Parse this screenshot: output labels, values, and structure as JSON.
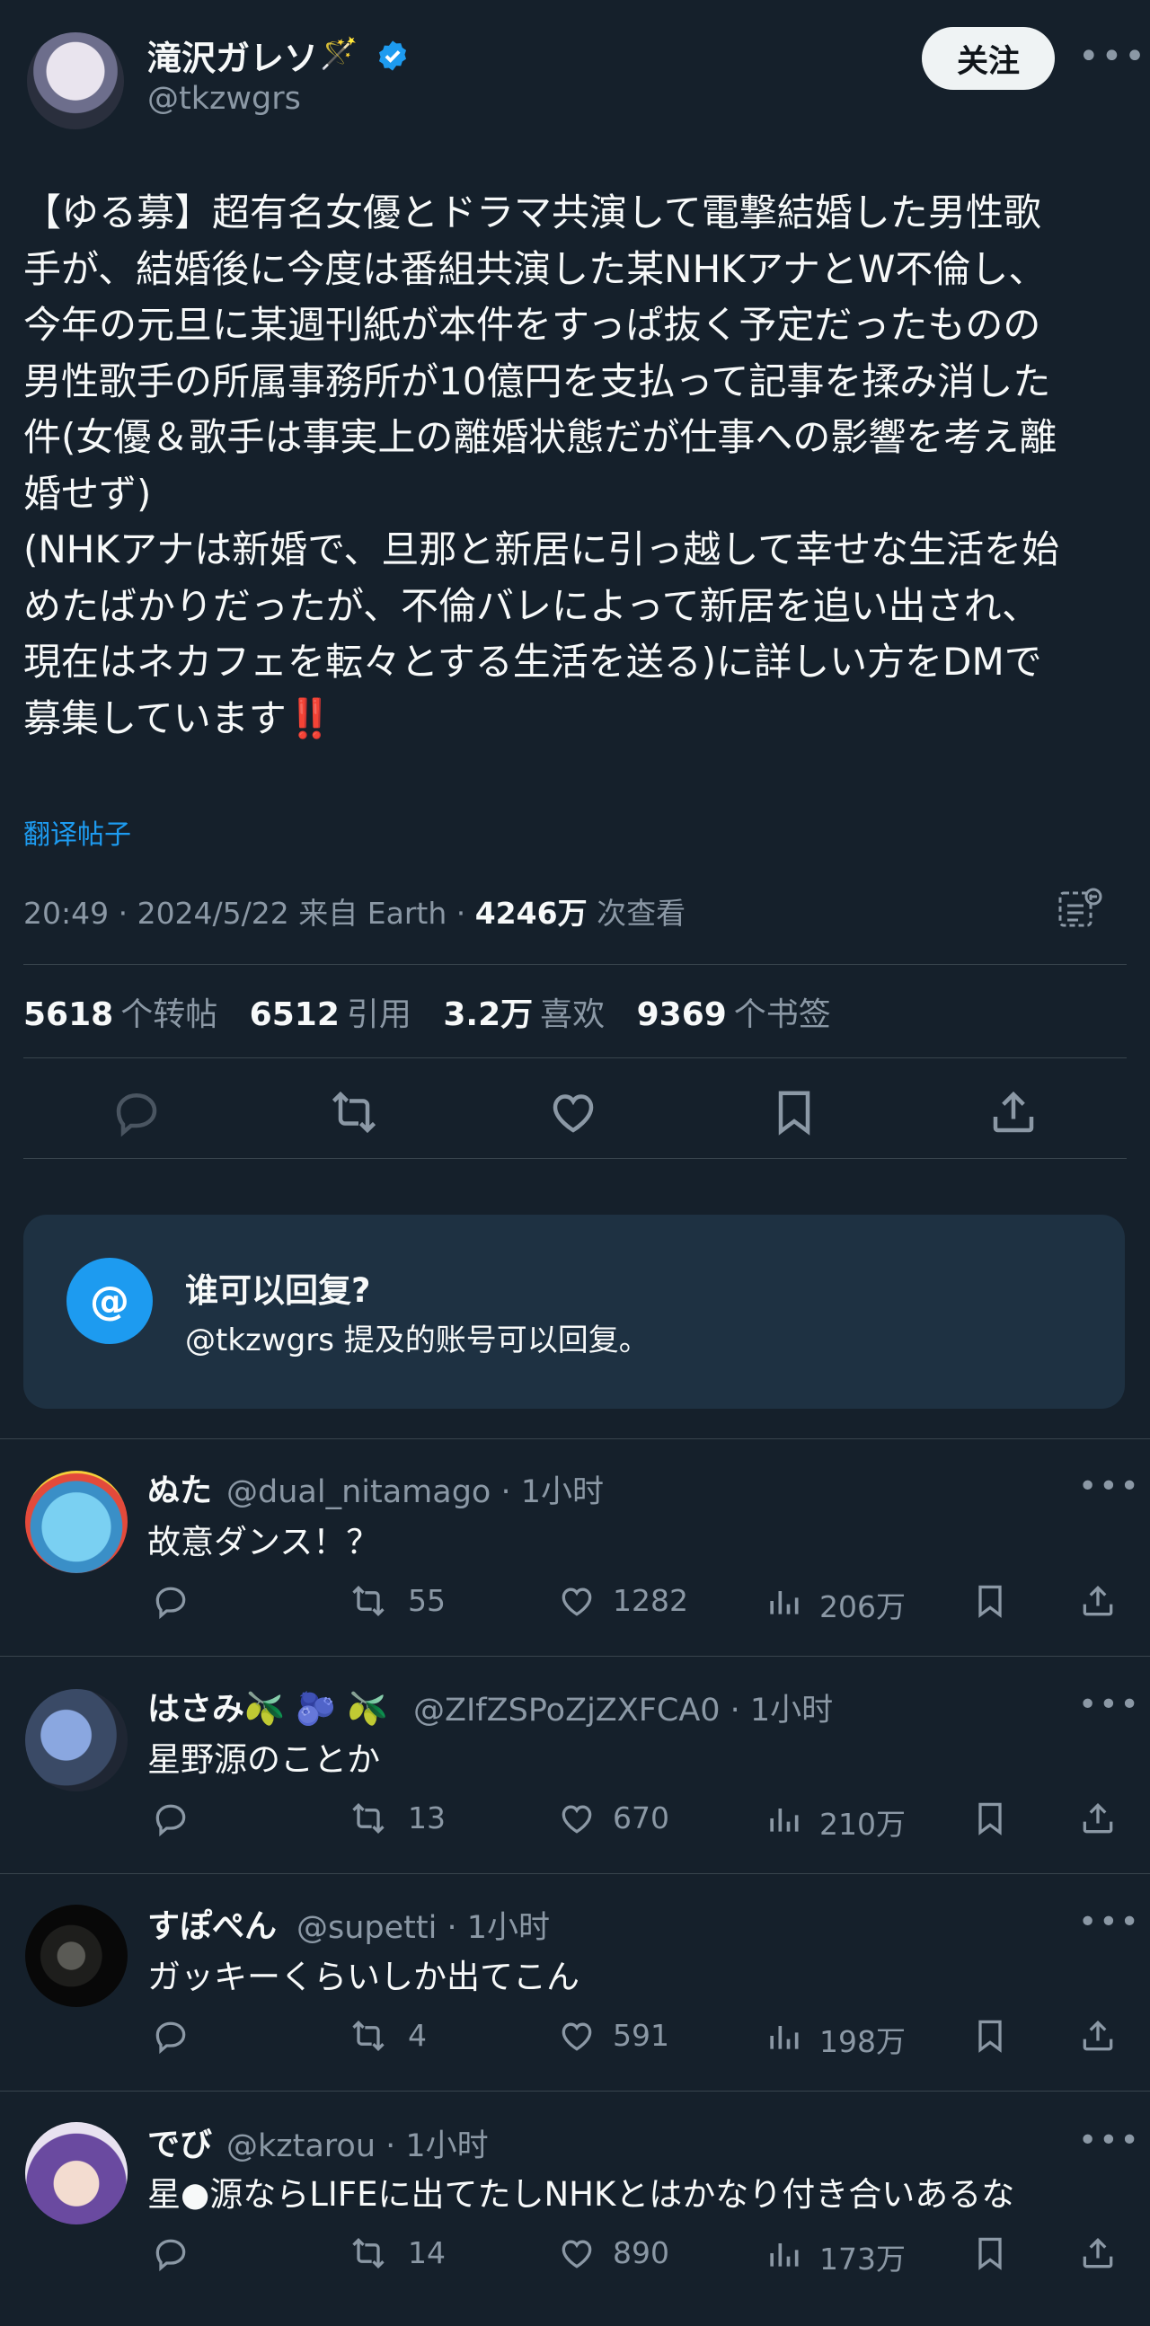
{
  "author": {
    "name": "滝沢ガレソ",
    "name_emoji": "🪄",
    "handle": "@tkzwgrs",
    "follow_label": "关注"
  },
  "tweet": {
    "lines": [
      "【ゆる募】超有名女優とドラマ共演して電撃結婚した男性歌",
      "手が、結婚後に今度は番組共演した某NHKアナとW不倫し、",
      "今年の元旦に某週刊紙が本件をすっぱ抜く予定だったものの",
      "男性歌手の所属事務所が10億円を支払って記事を揉み消した",
      "件(女優＆歌手は事実上の離婚状態だが仕事への影響を考え離",
      "婚せず)",
      "(NHKアナは新婚で、旦那と新居に引っ越して幸せな生活を始",
      "めたばかりだったが、不倫バレによって新居を追い出され、",
      "現在はネカフェを転々とする生活を送る)に詳しい方をDMで",
      "募集しています"
    ],
    "end_emoji": "‼️",
    "translate": "翻译帖子",
    "time": "20:49 · 2024/5/22 来自 Earth · ",
    "views": "4246万",
    "views_suffix": " 次查看"
  },
  "stats": {
    "reposts": "5618",
    "reposts_label": "个转帖",
    "quotes": "6512",
    "quotes_label": "引用",
    "likes": "3.2万",
    "likes_label": "喜欢",
    "bookmarks": "9369",
    "bookmarks_label": "个书签"
  },
  "who_can_reply": {
    "icon": "@",
    "title": "谁可以回复?",
    "subtitle": "@tkzwgrs 提及的账号可以回复。"
  },
  "replies": [
    {
      "name": "ぬた",
      "handle": "@dual_nitamago · 1小时",
      "text": "故意ダンス！？",
      "retweets": "55",
      "likes": "1282",
      "views": "206万",
      "avatar_color": "#58b6e0"
    },
    {
      "name": "はさみ🫒 🫐 🫒",
      "handle": "@ZIfZSPoZjZXFCA0 · 1小时",
      "text": "星野源のことか",
      "retweets": "13",
      "likes": "670",
      "views": "210万",
      "avatar_color": "#3a4a66"
    },
    {
      "name": "すぽぺん",
      "handle": "@supetti · 1小时",
      "text": "ガッキーくらいしか出てこん",
      "retweets": "4",
      "likes": "591",
      "views": "198万",
      "avatar_color": "#0c0c0c"
    },
    {
      "name": "でび",
      "handle": "@kztarou · 1小时",
      "text": "星●源ならLIFEに出てたしNHKとはかなり付き合いあるな",
      "retweets": "14",
      "likes": "890",
      "views": "173万",
      "avatar_color": "#5b3f8a"
    }
  ],
  "colors": {
    "background": "#15202b",
    "accent": "#1d9bf0",
    "secondary_text": "#8b98a5",
    "divider": "#38444d"
  }
}
